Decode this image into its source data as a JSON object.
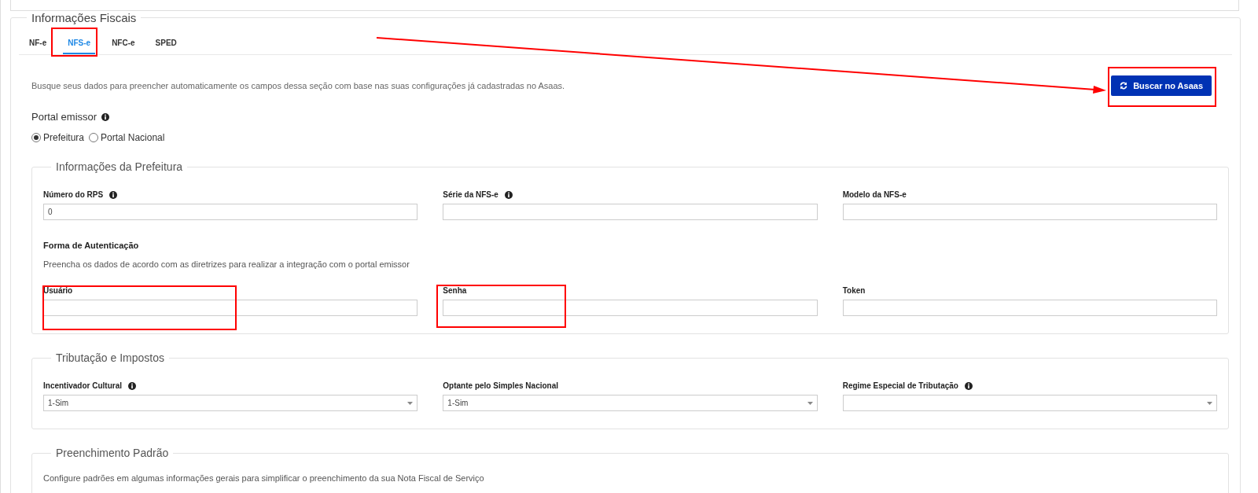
{
  "section": {
    "legend": "Informações Fiscais",
    "tabs": [
      {
        "label": "NF-e",
        "selected": false
      },
      {
        "label": "NFS-e",
        "selected": true
      },
      {
        "label": "NFC-e",
        "selected": false
      },
      {
        "label": "SPED",
        "selected": false
      }
    ],
    "hint": "Busque seus dados para preencher automaticamente os campos dessa seção com base nas suas configurações já cadastradas no Asaas.",
    "fetch_button": "Buscar no Asaas",
    "portal": {
      "label": "Portal emissor",
      "info": true,
      "options": [
        {
          "label": "Prefeitura",
          "selected": true
        },
        {
          "label": "Portal Nacional",
          "selected": false
        }
      ]
    },
    "groups": [
      {
        "legend": "Informações da Prefeitura",
        "items": [
          {
            "kind": "fields",
            "fields": [
              {
                "label": "Número do RPS",
                "info": true,
                "kind": "input",
                "value": "0"
              },
              {
                "label": "Série da NFS-e",
                "info": true,
                "kind": "input"
              },
              {
                "label": "Modelo da NFS-e",
                "info": false,
                "kind": "input"
              }
            ]
          },
          {
            "kind": "heading",
            "text": "Forma de Autenticação"
          },
          {
            "kind": "text",
            "text": "Preencha os dados de acordo com as diretrizes para realizar a integração com o portal emissor"
          },
          {
            "kind": "fields",
            "fields": [
              {
                "label": "Usuário",
                "info": false,
                "kind": "input"
              },
              {
                "label": "Senha",
                "info": false,
                "kind": "input"
              },
              {
                "label": "Token",
                "info": false,
                "kind": "input"
              }
            ]
          }
        ]
      },
      {
        "legend": "Tributação e Impostos",
        "items": [
          {
            "kind": "fields",
            "fields": [
              {
                "label": "Incentivador Cultural",
                "info": true,
                "kind": "select",
                "value": "1-Sim"
              },
              {
                "label": "Optante pelo Simples Nacional",
                "info": false,
                "kind": "select",
                "value": "1-Sim"
              },
              {
                "label": "Regime Especial de Tributação",
                "info": true,
                "kind": "select"
              }
            ]
          }
        ]
      },
      {
        "legend": "Preenchimento Padrão",
        "items": [
          {
            "kind": "text",
            "text": "Configure padrões em algumas informações gerais para simplificar o preenchimento da sua Nota Fiscal de Serviço"
          }
        ]
      }
    ]
  }
}
